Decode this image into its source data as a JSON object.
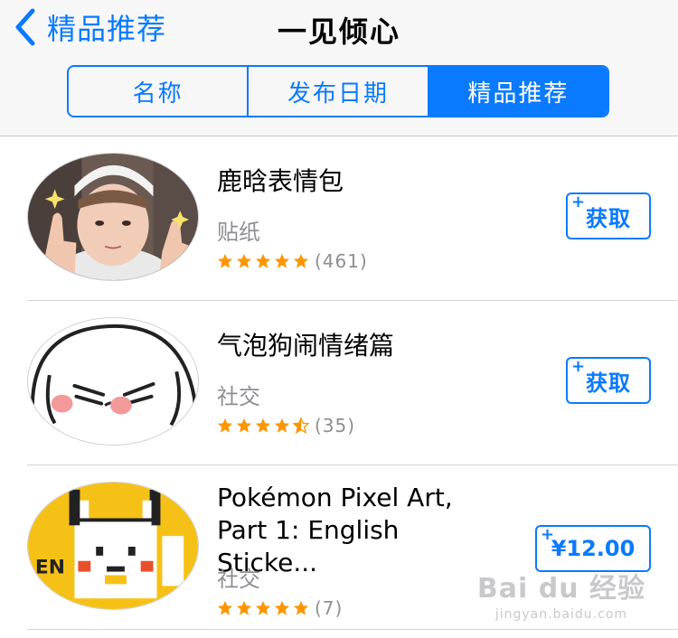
{
  "nav": {
    "back_label": "精品推荐",
    "title": "一见倾心"
  },
  "segments": [
    {
      "label": "名称",
      "selected": false
    },
    {
      "label": "发布日期",
      "selected": false
    },
    {
      "label": "精品推荐",
      "selected": true
    }
  ],
  "apps": [
    {
      "name": "鹿晗表情包",
      "category": "贴纸",
      "rating": 5,
      "rating_count": "(461)",
      "action": "获取",
      "action_plus": "+",
      "icon": "sticker-photo-thumbnail"
    },
    {
      "name": "气泡狗闹情绪篇",
      "category": "社交",
      "rating": 4.5,
      "rating_count": "(35)",
      "action": "获取",
      "action_plus": "+",
      "icon": "bubble-dog-thumbnail"
    },
    {
      "name_line1": "Pokémon Pixel Art,",
      "name_line2": "Part 1: English Sticke...",
      "category": "社交",
      "rating": 5,
      "rating_count": "(7)",
      "action": "¥12.00",
      "action_plus": "+",
      "icon": "pixel-pikachu-thumbnail",
      "thumb_text": "EN"
    }
  ],
  "watermark": {
    "main": "Bai du 经验",
    "sub": "jingyan.baidu.com"
  },
  "colors": {
    "accent": "#0a7aff",
    "star": "#ff9500",
    "secondary_text": "#8e8e93",
    "bar_bg": "#f7f7f8"
  }
}
